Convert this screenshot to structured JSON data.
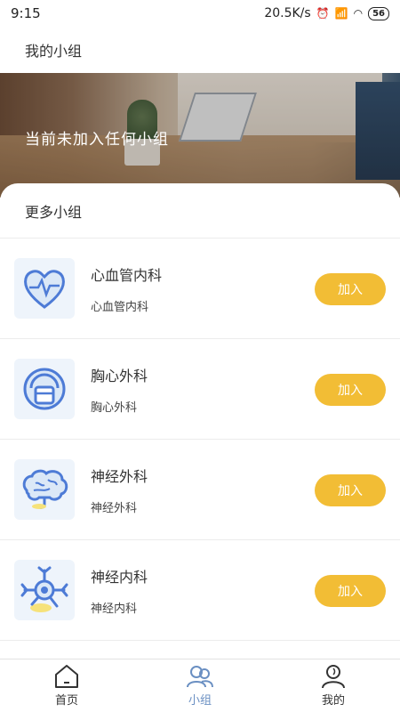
{
  "status": {
    "time": "9:15",
    "network_speed": "20.5K/s",
    "battery": "56"
  },
  "header": {
    "title": "我的小组"
  },
  "banner": {
    "text": "当前未加入任何小组"
  },
  "section": {
    "title": "更多小组"
  },
  "groups": [
    {
      "name": "心血管内科",
      "subtitle": "心血管内科",
      "icon": "heart-pulse-icon",
      "join_label": "加入"
    },
    {
      "name": "胸心外科",
      "subtitle": "胸心外科",
      "icon": "chest-organ-icon",
      "join_label": "加入"
    },
    {
      "name": "神经外科",
      "subtitle": "神经外科",
      "icon": "brain-icon",
      "join_label": "加入"
    },
    {
      "name": "神经内科",
      "subtitle": "神经内科",
      "icon": "neuron-icon",
      "join_label": "加入"
    }
  ],
  "nav": [
    {
      "label": "首页",
      "icon": "home-icon",
      "active": false
    },
    {
      "label": "小组",
      "icon": "group-icon",
      "active": true
    },
    {
      "label": "我的",
      "icon": "profile-icon",
      "active": false
    }
  ],
  "colors": {
    "accent": "#f2bd35",
    "nav_active": "#6a8fc2",
    "icon_blue": "#4d7bd6"
  }
}
